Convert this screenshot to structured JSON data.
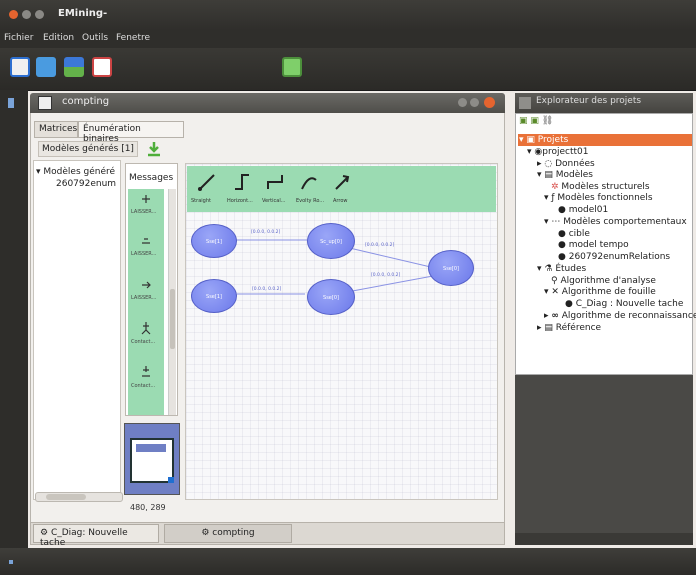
{
  "window": {
    "title": "EMining-"
  },
  "menu": [
    "Fichier",
    "Edition",
    "Outils",
    "Fenetre"
  ],
  "editor": {
    "title": "compting",
    "tabs": [
      "Matrices",
      "Énumération binaires"
    ],
    "subtab": "Modèles générés [1]",
    "tree": [
      "Modèles généré",
      "260792enum"
    ],
    "palette_title": "Messages",
    "palette_items": [
      "LAISSER...",
      "LAISSER...",
      "LAISSER...",
      "Contact...",
      "Contact..."
    ],
    "canvas_tools": [
      "Straight",
      "Horizont...",
      "Vertical...",
      "Evolty Ro...",
      "Arrow"
    ],
    "nodes": [
      "Sse[1]",
      "Sc_up[0]",
      "Sse[1]",
      "Sse[0]",
      "Sse[0]"
    ],
    "edge_labels": [
      "[0.0.0, 0.0.2]",
      "[0.0.0, 0.0.2]",
      "[0.0.0, 0.0.2]",
      "[0.0.0, 0.0.2]",
      "[0.0.0, 0.0.2]"
    ],
    "coords": "480, 289"
  },
  "bottom_tabs": [
    "C_Diag: Nouvelle tache",
    "compting"
  ],
  "explorer": {
    "title": "Explorateur des projets",
    "items": [
      "Projets",
      "projectt01",
      "Données",
      "Modèles",
      "Modèles structurels",
      "Modèles fonctionnels",
      "model01",
      "Modèles comportementaux",
      "cible",
      "model tempo",
      "260792enumRelations",
      "Études",
      "Algorithme d'analyse",
      "Algorithme de fouille",
      "C_Diag : Nouvelle tache",
      "Algorithme de reconnaissance",
      "Référence"
    ]
  },
  "colors": {
    "accent": "#e97138",
    "palette_green": "#9bdbb2",
    "node_blue": "#7b86ee"
  }
}
